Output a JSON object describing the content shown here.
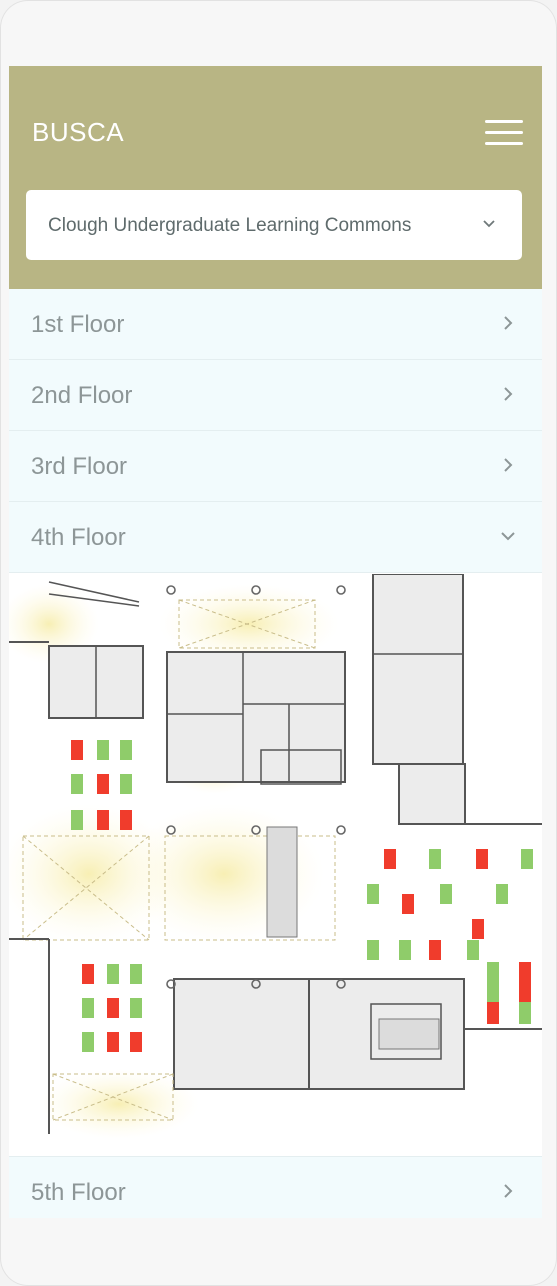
{
  "app": {
    "title": "BUSCA"
  },
  "header": {
    "menu_icon": "hamburger-menu-icon"
  },
  "building_select": {
    "selected": "Clough Undergraduate Learning Commons"
  },
  "floors": [
    {
      "label": "1st Floor",
      "expanded": false
    },
    {
      "label": "2nd Floor",
      "expanded": false
    },
    {
      "label": "3rd Floor",
      "expanded": false
    },
    {
      "label": "4th Floor",
      "expanded": true
    },
    {
      "label": "5th Floor",
      "expanded": false
    }
  ],
  "seat_status_colors": {
    "available": "#8fcc6a",
    "occupied": "#f03c2c"
  },
  "colors": {
    "header": "#b8b584",
    "floor_row_bg": "#f2fbfd",
    "floor_text": "#8d9697"
  }
}
